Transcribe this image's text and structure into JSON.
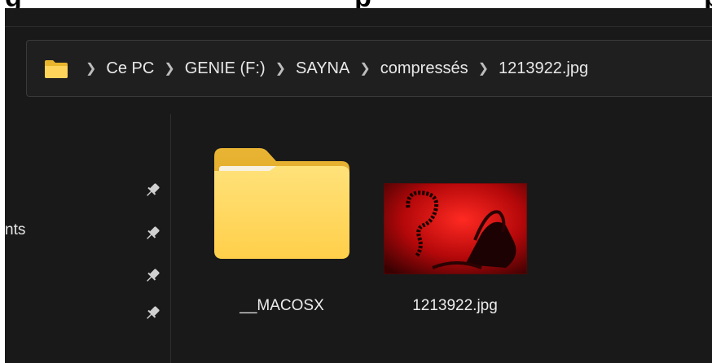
{
  "cropped_heading": "g                                         p                                         p",
  "breadcrumb": {
    "root_icon": "folder-icon",
    "separator_icon": "chevron-right-icon",
    "items": [
      "Ce PC",
      "GENIE (F:)",
      "SAYNA",
      "compressés",
      "1213922.jpg"
    ]
  },
  "sidebar": {
    "partial_item_label": "nts",
    "pin_icon": "pin-icon",
    "pin_count": 4
  },
  "files": [
    {
      "name": "__MACOSX",
      "type": "folder",
      "icon": "folder-icon"
    },
    {
      "name": "1213922.jpg",
      "type": "image",
      "icon": "image-thumbnail"
    }
  ],
  "colors": {
    "background": "#191919",
    "address_bar": "#1f1f1f",
    "text": "#e8e8e8",
    "folder_yellow": "#ffd45a",
    "thumbnail_red": "#b5080a"
  }
}
